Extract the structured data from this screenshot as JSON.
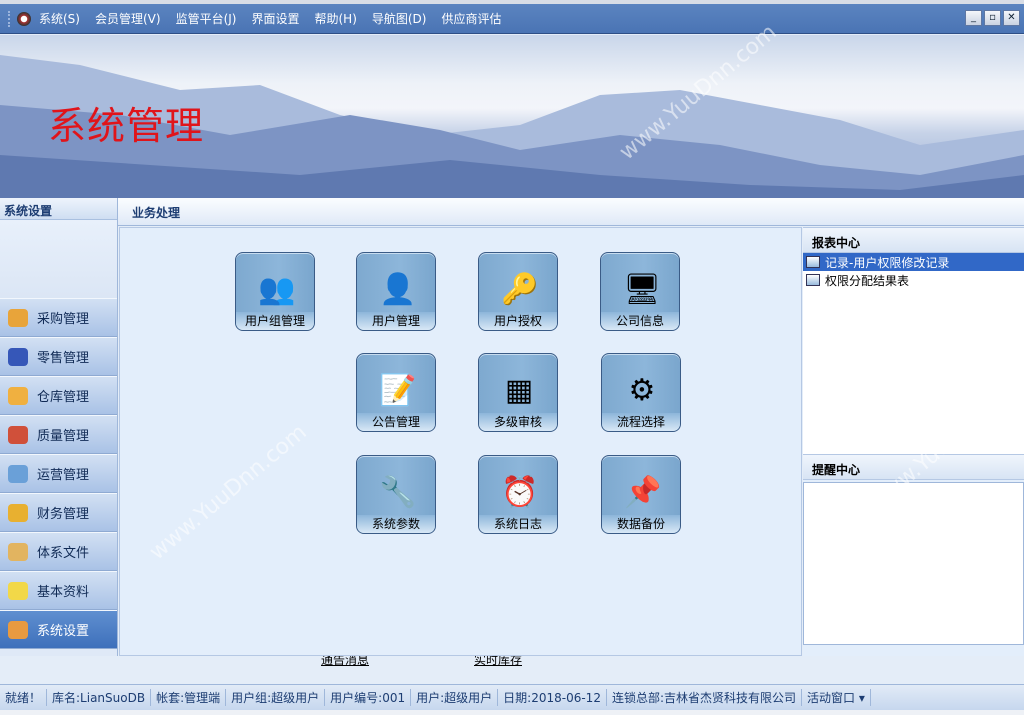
{
  "menubar": {
    "items": [
      "系统(S)",
      "会员管理(V)",
      "监管平台(J)",
      "界面设置",
      "帮助(H)",
      "导航图(D)",
      "供应商评估"
    ],
    "window_buttons": [
      "_",
      "▫",
      "✕"
    ]
  },
  "banner": {
    "title": "系统管理"
  },
  "left": {
    "header": "系统设置",
    "items": [
      {
        "label": "采购管理",
        "icon": "purchase-icon",
        "color": "#e8a43a"
      },
      {
        "label": "零售管理",
        "icon": "retail-icon",
        "color": "#3657b8"
      },
      {
        "label": "仓库管理",
        "icon": "warehouse-icon",
        "color": "#f0b040"
      },
      {
        "label": "质量管理",
        "icon": "quality-icon",
        "color": "#d0503a"
      },
      {
        "label": "运营管理",
        "icon": "operations-icon",
        "color": "#6aa0d8"
      },
      {
        "label": "财务管理",
        "icon": "finance-icon",
        "color": "#e8b030"
      },
      {
        "label": "体系文件",
        "icon": "folder-icon",
        "color": "#e2b460"
      },
      {
        "label": "基本资料",
        "icon": "basic-data-icon",
        "color": "#f2d848"
      },
      {
        "label": "系统设置",
        "icon": "system-settings-icon",
        "color": "#e89a40",
        "active": true
      }
    ]
  },
  "main": {
    "header": "业务处理",
    "tiles": [
      {
        "label": "用户组管理",
        "icon": "user-group-icon",
        "glyph": "👥"
      },
      {
        "label": "用户管理",
        "icon": "user-icon",
        "glyph": "👤"
      },
      {
        "label": "用户授权",
        "icon": "key-lock-icon",
        "glyph": "🔑"
      },
      {
        "label": "公司信息",
        "icon": "computer-icon",
        "glyph": "🖥"
      },
      {
        "label": "公告管理",
        "icon": "notice-icon",
        "glyph": "📝"
      },
      {
        "label": "多级审核",
        "icon": "hierarchy-icon",
        "glyph": "▦"
      },
      {
        "label": "流程选择",
        "icon": "gear-icon",
        "glyph": "⚙"
      },
      {
        "label": "系统参数",
        "icon": "tools-disc-icon",
        "glyph": "🔧"
      },
      {
        "label": "系统日志",
        "icon": "alarm-clock-icon",
        "glyph": "⏰"
      },
      {
        "label": "数据备份",
        "icon": "pushpin-icon",
        "glyph": "📌"
      }
    ]
  },
  "right": {
    "report_header": "报表中心",
    "reports": [
      {
        "label": "记录-用户权限修改记录",
        "selected": true
      },
      {
        "label": "权限分配结果表"
      }
    ],
    "remind_header": "提醒中心"
  },
  "bottom_links": [
    "通告消息",
    "实时库存"
  ],
  "status": [
    "就绪！",
    "库名:LianSuoDB",
    "帐套:管理端",
    "用户组:超级用户",
    "用户编号:001",
    "用户:超级用户",
    "日期:2018-06-12",
    "连锁总部:吉林省杰贤科技有限公司",
    "活动窗口 ▾"
  ]
}
